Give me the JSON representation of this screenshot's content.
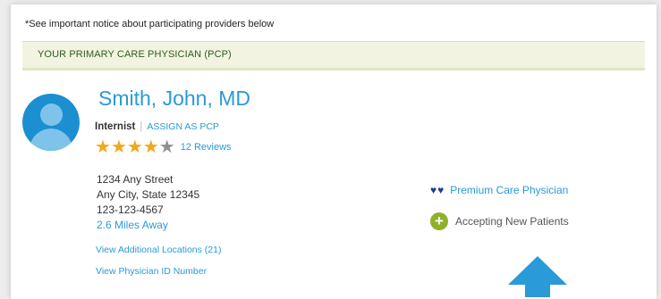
{
  "notice": "*See important notice about participating providers below",
  "pcp_band": "YOUR PRIMARY CARE PHYSICIAN (PCP)",
  "physician": {
    "name": "Smith, John, MD",
    "specialty": "Internist",
    "separator": "|",
    "assign_label": "ASSIGN AS PCP",
    "rating": 4,
    "rating_max": 5,
    "reviews_label": "12 Reviews",
    "address": {
      "street": "1234 Any Street",
      "city_state": "Any City, State  12345",
      "phone": "123-123-4567",
      "distance": "2.6 Miles Away"
    },
    "links": {
      "additional_locations": "View Additional Locations (21)",
      "physician_id": "View Physician ID Number"
    }
  },
  "badges": {
    "premium": "Premium Care Physician",
    "accepting": "Accepting New Patients"
  },
  "icons": {
    "avatar": "user-avatar-icon",
    "star": "star-icon",
    "heart": "heart-icon",
    "plus": "plus-circle-icon",
    "arrow": "arrow-up-icon"
  },
  "colors": {
    "accent_blue": "#2a9ad8",
    "star_gold": "#f0a81c",
    "band_green": "#2c5e1e",
    "band_bg": "#f3f3e1",
    "heart_navy": "#1e3f8f",
    "plus_green": "#8fb02b",
    "arrow_blue": "#2a9ad8"
  }
}
